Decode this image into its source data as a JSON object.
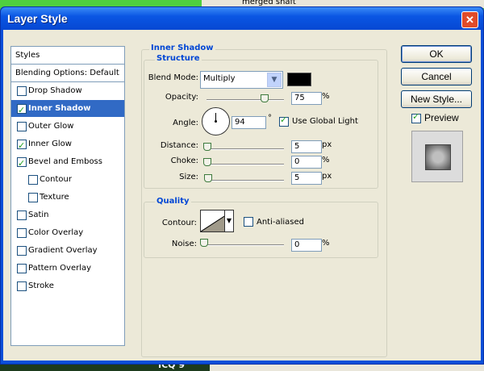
{
  "background": {
    "top_label": "merged shaft",
    "bottom_label": "ICQ 9"
  },
  "window": {
    "title": "Layer Style",
    "close_label": "✕"
  },
  "styles_list": {
    "header": "Styles",
    "blending": "Blending Options: Default",
    "items": [
      {
        "label": "Drop Shadow",
        "checked": false
      },
      {
        "label": "Inner Shadow",
        "checked": true
      },
      {
        "label": "Outer Glow",
        "checked": false
      },
      {
        "label": "Inner Glow",
        "checked": true
      },
      {
        "label": "Bevel and Emboss",
        "checked": true
      },
      {
        "label": "Contour",
        "checked": false
      },
      {
        "label": "Texture",
        "checked": false
      },
      {
        "label": "Satin",
        "checked": false
      },
      {
        "label": "Color Overlay",
        "checked": false
      },
      {
        "label": "Gradient Overlay",
        "checked": false
      },
      {
        "label": "Pattern Overlay",
        "checked": false
      },
      {
        "label": "Stroke",
        "checked": false
      }
    ]
  },
  "inner_shadow": {
    "section_title": "Inner Shadow",
    "structure": {
      "title": "Structure",
      "blend_mode_label": "Blend Mode:",
      "blend_mode_value": "Multiply",
      "blend_color": "#000000",
      "opacity_label": "Opacity:",
      "opacity_value": "75",
      "opacity_unit": "%",
      "angle_label": "Angle:",
      "angle_value": "94",
      "angle_unit": "°",
      "global_light_label": "Use Global Light",
      "global_light_checked": true,
      "distance_label": "Distance:",
      "distance_value": "5",
      "distance_unit": "px",
      "choke_label": "Choke:",
      "choke_value": "0",
      "choke_unit": "%",
      "size_label": "Size:",
      "size_value": "5",
      "size_unit": "px"
    },
    "quality": {
      "title": "Quality",
      "contour_label": "Contour:",
      "anti_aliased_label": "Anti-aliased",
      "anti_aliased_checked": false,
      "noise_label": "Noise:",
      "noise_value": "0",
      "noise_unit": "%"
    }
  },
  "buttons": {
    "ok": "OK",
    "cancel": "Cancel",
    "new_style": "New Style...",
    "preview_label": "Preview",
    "preview_checked": true
  }
}
